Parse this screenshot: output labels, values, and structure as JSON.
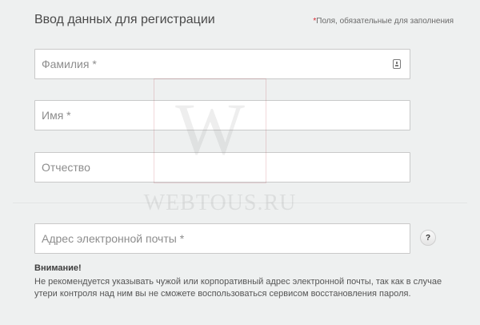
{
  "form": {
    "title": "Ввод данных для регистрации",
    "required_star": "*",
    "required_note": "Поля, обязательные для заполнения"
  },
  "fields": {
    "surname": {
      "placeholder": "Фамилия *",
      "value": ""
    },
    "name": {
      "placeholder": "Имя *",
      "value": ""
    },
    "patronymic": {
      "placeholder": "Отчество",
      "value": ""
    },
    "email": {
      "placeholder": "Адрес электронной почты *",
      "value": ""
    }
  },
  "help": {
    "label": "?"
  },
  "warning": {
    "title": "Внимание!",
    "text": "Не рекомендуется указывать чужой или корпоративный адрес электронной почты, так как в случае утери контроля над ним вы не сможете воспользоваться сервисом восстановления пароля."
  },
  "watermark": {
    "glyph": "W",
    "text": "WEBTOUS.RU"
  },
  "icons": {
    "surname_field_icon": "contact-card-icon",
    "help_icon": "question-mark-icon"
  },
  "colors": {
    "background": "#eef0f0",
    "required_star": "#d9232e",
    "field_border": "#c9c9c9"
  }
}
